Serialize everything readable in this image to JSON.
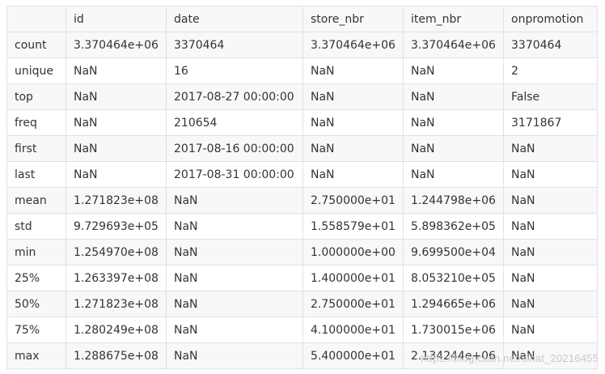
{
  "table": {
    "headers": [
      "",
      "id",
      "date",
      "store_nbr",
      "item_nbr",
      "onpromotion"
    ],
    "rows": [
      [
        "count",
        "3.370464e+06",
        "3370464",
        "3.370464e+06",
        "3.370464e+06",
        "3370464"
      ],
      [
        "unique",
        "NaN",
        "16",
        "NaN",
        "NaN",
        "2"
      ],
      [
        "top",
        "NaN",
        "2017-08-27 00:00:00",
        "NaN",
        "NaN",
        "False"
      ],
      [
        "freq",
        "NaN",
        "210654",
        "NaN",
        "NaN",
        "3171867"
      ],
      [
        "first",
        "NaN",
        "2017-08-16 00:00:00",
        "NaN",
        "NaN",
        "NaN"
      ],
      [
        "last",
        "NaN",
        "2017-08-31 00:00:00",
        "NaN",
        "NaN",
        "NaN"
      ],
      [
        "mean",
        "1.271823e+08",
        "NaN",
        "2.750000e+01",
        "1.244798e+06",
        "NaN"
      ],
      [
        "std",
        "9.729693e+05",
        "NaN",
        "1.558579e+01",
        "5.898362e+05",
        "NaN"
      ],
      [
        "min",
        "1.254970e+08",
        "NaN",
        "1.000000e+00",
        "9.699500e+04",
        "NaN"
      ],
      [
        "25%",
        "1.263397e+08",
        "NaN",
        "1.400000e+01",
        "8.053210e+05",
        "NaN"
      ],
      [
        "50%",
        "1.271823e+08",
        "NaN",
        "2.750000e+01",
        "1.294665e+06",
        "NaN"
      ],
      [
        "75%",
        "1.280249e+08",
        "NaN",
        "4.100000e+01",
        "1.730015e+06",
        "NaN"
      ],
      [
        "max",
        "1.288675e+08",
        "NaN",
        "5.400000e+01",
        "2.134244e+06",
        "NaN"
      ]
    ]
  },
  "watermark": "https://blog.csdn.net/sinat_20216455",
  "colors": {
    "border": "#dfe2e5",
    "row_alt_background": "#f8f8f8",
    "text": "#333333",
    "watermark": "#c8c8c8"
  }
}
